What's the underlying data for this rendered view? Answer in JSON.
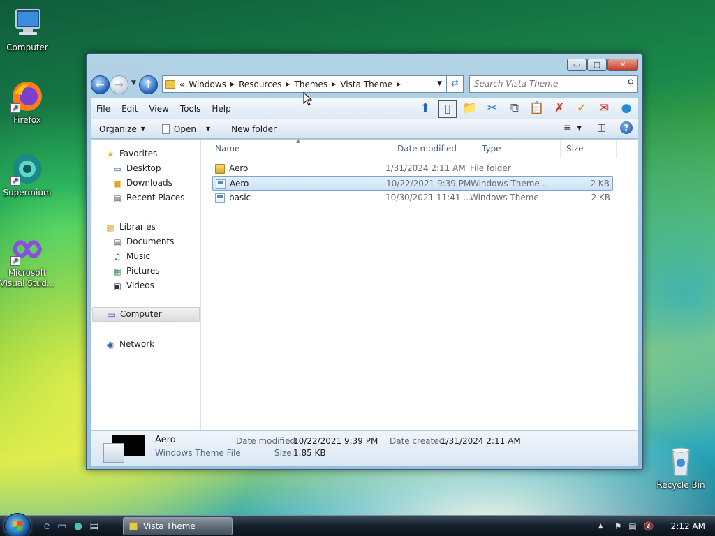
{
  "desktop": {
    "icons": [
      {
        "label": "Computer"
      },
      {
        "label": "Firefox"
      },
      {
        "label": "Supermium"
      },
      {
        "label": "Microsoft Visual Stud..."
      },
      {
        "label": "Recycle Bin"
      }
    ]
  },
  "window": {
    "caption": {
      "minimize": "▭",
      "maximize": "▢",
      "close": "✕"
    },
    "address": {
      "prefix": "«",
      "crumbs": [
        "Windows",
        "Resources",
        "Themes",
        "Vista Theme"
      ]
    },
    "search": {
      "placeholder": "Search Vista Theme"
    },
    "menu": [
      "File",
      "Edit",
      "View",
      "Tools",
      "Help"
    ],
    "commands": {
      "organize": "Organize",
      "open": "Open",
      "new_folder": "New folder"
    },
    "nav": {
      "favorites": {
        "label": "Favorites",
        "items": [
          "Desktop",
          "Downloads",
          "Recent Places"
        ]
      },
      "libraries": {
        "label": "Libraries",
        "items": [
          "Documents",
          "Music",
          "Pictures",
          "Videos"
        ]
      },
      "computer": "Computer",
      "network": "Network"
    },
    "columns": {
      "name": "Name",
      "date": "Date modified",
      "type": "Type",
      "size": "Size"
    },
    "files": [
      {
        "name": "Aero",
        "date": "1/31/2024 2:11 AM",
        "type": "File folder",
        "size": "",
        "icon": "folder-icon"
      },
      {
        "name": "Aero",
        "date": "10/22/2021 9:39 PM",
        "type": "Windows Theme ...",
        "size": "2 KB",
        "icon": "theme-file-icon"
      },
      {
        "name": "basic",
        "date": "10/30/2021 11:41 ...",
        "type": "Windows Theme ...",
        "size": "2 KB",
        "icon": "theme-file-icon"
      }
    ],
    "details": {
      "name": "Aero",
      "type": "Windows Theme File",
      "modified_label": "Date modified:",
      "modified": "10/22/2021 9:39 PM",
      "size_label": "Size:",
      "size": "1.85 KB",
      "created_label": "Date created:",
      "created": "1/31/2024 2:11 AM"
    }
  },
  "taskbar": {
    "task_label": "Vista Theme",
    "clock": "2:12 AM"
  }
}
